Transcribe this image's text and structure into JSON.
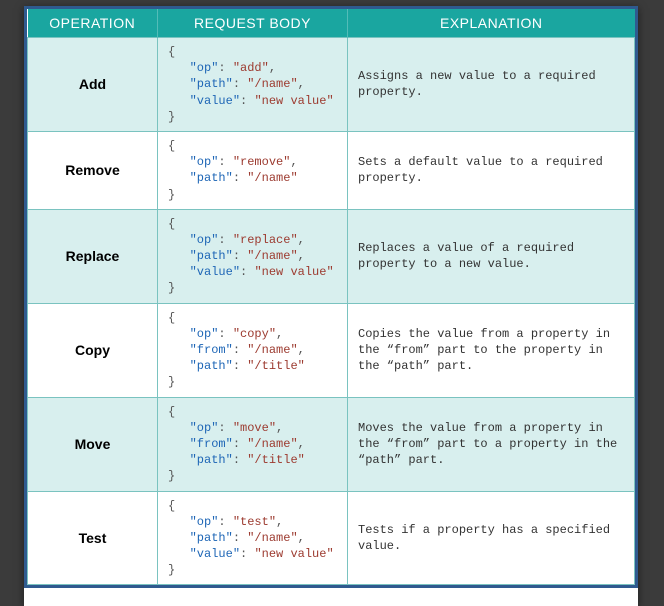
{
  "headers": {
    "op": "OPERATION",
    "body": "REQUEST BODY",
    "exp": "EXPLANATION"
  },
  "rows": [
    {
      "name": "Add",
      "body": [
        {
          "k": "op",
          "v": "add"
        },
        {
          "k": "path",
          "v": "/name"
        },
        {
          "k": "value",
          "v": "new value"
        }
      ],
      "exp": "Assigns a new value to a required property."
    },
    {
      "name": "Remove",
      "body": [
        {
          "k": "op",
          "v": "remove"
        },
        {
          "k": "path",
          "v": "/name"
        }
      ],
      "exp": "Sets a default value to a required property."
    },
    {
      "name": "Replace",
      "body": [
        {
          "k": "op",
          "v": "replace"
        },
        {
          "k": "path",
          "v": "/name"
        },
        {
          "k": "value",
          "v": "new value"
        }
      ],
      "exp": "Replaces a value of a required property to a new value."
    },
    {
      "name": "Copy",
      "body": [
        {
          "k": "op",
          "v": "copy"
        },
        {
          "k": "from",
          "v": "/name"
        },
        {
          "k": "path",
          "v": "/title"
        }
      ],
      "exp": "Copies the value from a property in the “from” part to the property in the “path” part."
    },
    {
      "name": "Move",
      "body": [
        {
          "k": "op",
          "v": "move"
        },
        {
          "k": "from",
          "v": "/name"
        },
        {
          "k": "path",
          "v": "/title"
        }
      ],
      "exp": "Moves the value from a property in the “from” part to a property in the “path” part."
    },
    {
      "name": "Test",
      "body": [
        {
          "k": "op",
          "v": "test"
        },
        {
          "k": "path",
          "v": "/name"
        },
        {
          "k": "value",
          "v": "new value"
        }
      ],
      "exp": "Tests if a property has a specified value."
    }
  ]
}
